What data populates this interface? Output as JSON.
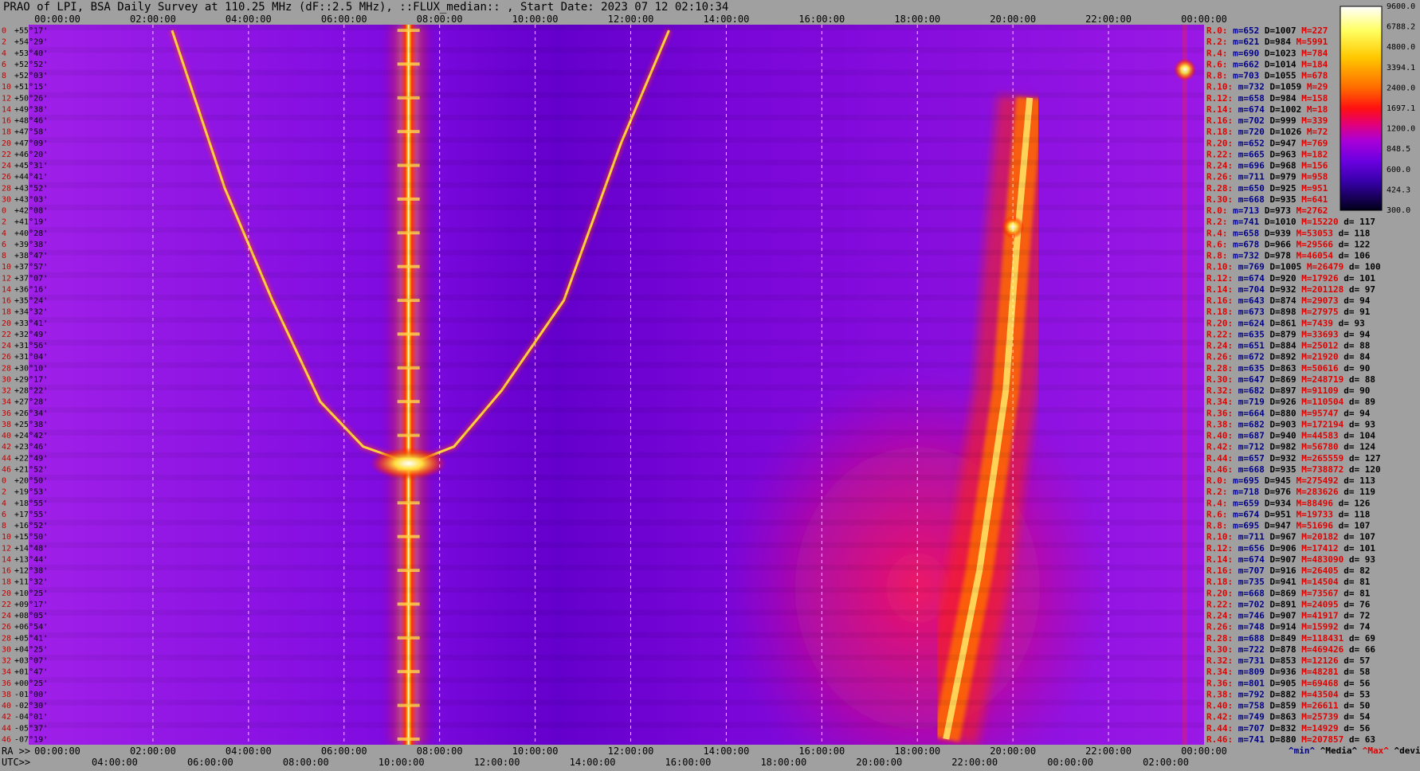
{
  "title": "PRAO of LPI, BSA Daily Survey at 110.25 MHz (dF::2.5 MHz), ::FLUX_median:: , Start Date: 2023 07 12 02:10:34",
  "x_axis_top_ticks": [
    "00:00:00",
    "02:00:00",
    "04:00:00",
    "06:00:00",
    "08:00:00",
    "10:00:00",
    "12:00:00",
    "14:00:00",
    "16:00:00",
    "18:00:00",
    "20:00:00",
    "22:00:00",
    "00:00:00"
  ],
  "x_axis_bottom_ra_ticks": [
    "00:00:00",
    "02:00:00",
    "04:00:00",
    "06:00:00",
    "08:00:00",
    "10:00:00",
    "12:00:00",
    "14:00:00",
    "16:00:00",
    "18:00:00",
    "20:00:00",
    "22:00:00",
    "00:00:00"
  ],
  "x_axis_bottom_utc_ticks": [
    "04:00:00",
    "06:00:00",
    "08:00:00",
    "10:00:00",
    "12:00:00",
    "14:00:00",
    "16:00:00",
    "18:00:00",
    "20:00:00",
    "22:00:00",
    "00:00:00",
    "02:00:00"
  ],
  "ra_label": "RA >>",
  "utc_label": "UTC>>",
  "row_index_labels": [
    "0",
    "2",
    "4",
    "6",
    "8",
    "10",
    "12",
    "14",
    "16",
    "18",
    "20",
    "22",
    "24",
    "26",
    "28",
    "30",
    "0",
    "2",
    "4",
    "6",
    "8",
    "10",
    "12",
    "14",
    "16",
    "18",
    "20",
    "22",
    "24",
    "26",
    "28",
    "30",
    "32",
    "34",
    "36",
    "38",
    "40",
    "42",
    "44",
    "46",
    "0",
    "2",
    "4",
    "6",
    "8",
    "10",
    "12",
    "14",
    "16",
    "18",
    "20",
    "22",
    "24",
    "26",
    "28",
    "30",
    "32",
    "34",
    "36",
    "38",
    "40",
    "42",
    "44",
    "46"
  ],
  "dec_labels": [
    "+55°17'",
    "+54°29'",
    "+53°40'",
    "+52°52'",
    "+52°03'",
    "+51°15'",
    "+50°26'",
    "+49°38'",
    "+48°46'",
    "+47°58'",
    "+47°09'",
    "+46°20'",
    "+45°31'",
    "+44°41'",
    "+43°52'",
    "+43°03'",
    "+42°08'",
    "+41°19'",
    "+40°28'",
    "+39°38'",
    "+38°47'",
    "+37°57'",
    "+37°07'",
    "+36°16'",
    "+35°24'",
    "+34°32'",
    "+33°41'",
    "+32°49'",
    "+31°56'",
    "+31°04'",
    "+30°10'",
    "+29°17'",
    "+28°22'",
    "+27°28'",
    "+26°34'",
    "+25°38'",
    "+24°42'",
    "+23°46'",
    "+22°49'",
    "+21°52'",
    "+20°50'",
    "+19°53'",
    "+18°55'",
    "+17°55'",
    "+16°52'",
    "+15°50'",
    "+14°48'",
    "+13°44'",
    "+12°38'",
    "+11°32'",
    "+10°25'",
    "+09°17'",
    "+08°05'",
    "+06°54'",
    "+05°41'",
    "+04°25'",
    "+03°07'",
    "+01°47'",
    "+00°25'",
    "-01°00'",
    "-02°30'",
    "-04°01'",
    "-05°37'",
    "-07°19'"
  ],
  "stats": [
    {
      "r": "R.0:",
      "m": "m=652",
      "d": "D=1007",
      "h": "M=227",
      "dd": ""
    },
    {
      "r": "R.2:",
      "m": "m=621",
      "d": "D=984",
      "h": "M=5991",
      "dd": ""
    },
    {
      "r": "R.4:",
      "m": "m=690",
      "d": "D=1023",
      "h": "M=784",
      "dd": ""
    },
    {
      "r": "R.6:",
      "m": "m=662",
      "d": "D=1014",
      "h": "M=184",
      "dd": ""
    },
    {
      "r": "R.8:",
      "m": "m=703",
      "d": "D=1055",
      "h": "M=678",
      "dd": ""
    },
    {
      "r": "R.10:",
      "m": "m=732",
      "d": "D=1059",
      "h": "M=29",
      "dd": ""
    },
    {
      "r": "R.12:",
      "m": "m=658",
      "d": "D=984",
      "h": "M=158",
      "dd": ""
    },
    {
      "r": "R.14:",
      "m": "m=674",
      "d": "D=1002",
      "h": "M=18",
      "dd": ""
    },
    {
      "r": "R.16:",
      "m": "m=702",
      "d": "D=999",
      "h": "M=339",
      "dd": ""
    },
    {
      "r": "R.18:",
      "m": "m=720",
      "d": "D=1026",
      "h": "M=72",
      "dd": ""
    },
    {
      "r": "R.20:",
      "m": "m=652",
      "d": "D=947",
      "h": "M=769",
      "dd": ""
    },
    {
      "r": "R.22:",
      "m": "m=665",
      "d": "D=963",
      "h": "M=182",
      "dd": ""
    },
    {
      "r": "R.24:",
      "m": "m=696",
      "d": "D=968",
      "h": "M=156",
      "dd": ""
    },
    {
      "r": "R.26:",
      "m": "m=711",
      "d": "D=979",
      "h": "M=958",
      "dd": ""
    },
    {
      "r": "R.28:",
      "m": "m=650",
      "d": "D=925",
      "h": "M=951",
      "dd": ""
    },
    {
      "r": "R.30:",
      "m": "m=668",
      "d": "D=935",
      "h": "M=641",
      "dd": ""
    },
    {
      "r": "R.0:",
      "m": "m=713",
      "d": "D=973",
      "h": "M=2762",
      "dd": ""
    },
    {
      "r": "R.2:",
      "m": "m=741",
      "d": "D=1010",
      "h": "M=15220",
      "dd": "d= 117"
    },
    {
      "r": "R.4:",
      "m": "m=658",
      "d": "D=939",
      "h": "M=53053",
      "dd": "d= 118"
    },
    {
      "r": "R.6:",
      "m": "m=678",
      "d": "D=966",
      "h": "M=29566",
      "dd": "d= 122"
    },
    {
      "r": "R.8:",
      "m": "m=732",
      "d": "D=978",
      "h": "M=46054",
      "dd": "d= 106"
    },
    {
      "r": "R.10:",
      "m": "m=769",
      "d": "D=1005",
      "h": "M=26479",
      "dd": "d= 100"
    },
    {
      "r": "R.12:",
      "m": "m=674",
      "d": "D=920",
      "h": "M=17926",
      "dd": "d= 101"
    },
    {
      "r": "R.14:",
      "m": "m=704",
      "d": "D=932",
      "h": "M=201128",
      "dd": "d= 97"
    },
    {
      "r": "R.16:",
      "m": "m=643",
      "d": "D=874",
      "h": "M=29073",
      "dd": "d= 94"
    },
    {
      "r": "R.18:",
      "m": "m=673",
      "d": "D=898",
      "h": "M=27975",
      "dd": "d= 91"
    },
    {
      "r": "R.20:",
      "m": "m=624",
      "d": "D=861",
      "h": "M=7439",
      "dd": "d= 93"
    },
    {
      "r": "R.22:",
      "m": "m=635",
      "d": "D=879",
      "h": "M=33693",
      "dd": "d= 94"
    },
    {
      "r": "R.24:",
      "m": "m=651",
      "d": "D=884",
      "h": "M=25012",
      "dd": "d= 88"
    },
    {
      "r": "R.26:",
      "m": "m=672",
      "d": "D=892",
      "h": "M=21920",
      "dd": "d= 84"
    },
    {
      "r": "R.28:",
      "m": "m=635",
      "d": "D=863",
      "h": "M=50616",
      "dd": "d= 90"
    },
    {
      "r": "R.30:",
      "m": "m=647",
      "d": "D=869",
      "h": "M=248719",
      "dd": "d= 88"
    },
    {
      "r": "R.32:",
      "m": "m=682",
      "d": "D=897",
      "h": "M=91109",
      "dd": "d= 90"
    },
    {
      "r": "R.34:",
      "m": "m=719",
      "d": "D=926",
      "h": "M=110504",
      "dd": "d= 89"
    },
    {
      "r": "R.36:",
      "m": "m=664",
      "d": "D=880",
      "h": "M=95747",
      "dd": "d= 94"
    },
    {
      "r": "R.38:",
      "m": "m=682",
      "d": "D=903",
      "h": "M=172194",
      "dd": "d= 93"
    },
    {
      "r": "R.40:",
      "m": "m=687",
      "d": "D=940",
      "h": "M=44583",
      "dd": "d= 104"
    },
    {
      "r": "R.42:",
      "m": "m=712",
      "d": "D=982",
      "h": "M=56780",
      "dd": "d= 124"
    },
    {
      "r": "R.44:",
      "m": "m=657",
      "d": "D=932",
      "h": "M=265559",
      "dd": "d= 127"
    },
    {
      "r": "R.46:",
      "m": "m=668",
      "d": "D=935",
      "h": "M=738872",
      "dd": "d= 120"
    },
    {
      "r": "R.0:",
      "m": "m=695",
      "d": "D=945",
      "h": "M=275492",
      "dd": "d= 113"
    },
    {
      "r": "R.2:",
      "m": "m=718",
      "d": "D=976",
      "h": "M=283626",
      "dd": "d= 119"
    },
    {
      "r": "R.4:",
      "m": "m=659",
      "d": "D=934",
      "h": "M=88496",
      "dd": "d= 126"
    },
    {
      "r": "R.6:",
      "m": "m=674",
      "d": "D=951",
      "h": "M=19733",
      "dd": "d= 118"
    },
    {
      "r": "R.8:",
      "m": "m=695",
      "d": "D=947",
      "h": "M=51696",
      "dd": "d= 107"
    },
    {
      "r": "R.10:",
      "m": "m=711",
      "d": "D=967",
      "h": "M=20182",
      "dd": "d= 107"
    },
    {
      "r": "R.12:",
      "m": "m=656",
      "d": "D=906",
      "h": "M=17412",
      "dd": "d= 101"
    },
    {
      "r": "R.14:",
      "m": "m=674",
      "d": "D=907",
      "h": "M=483090",
      "dd": "d= 93"
    },
    {
      "r": "R.16:",
      "m": "m=707",
      "d": "D=916",
      "h": "M=26405",
      "dd": "d= 82"
    },
    {
      "r": "R.18:",
      "m": "m=735",
      "d": "D=941",
      "h": "M=14504",
      "dd": "d= 81"
    },
    {
      "r": "R.20:",
      "m": "m=668",
      "d": "D=869",
      "h": "M=73567",
      "dd": "d= 81"
    },
    {
      "r": "R.22:",
      "m": "m=702",
      "d": "D=891",
      "h": "M=24095",
      "dd": "d= 76"
    },
    {
      "r": "R.24:",
      "m": "m=746",
      "d": "D=907",
      "h": "M=41917",
      "dd": "d= 72"
    },
    {
      "r": "R.26:",
      "m": "m=748",
      "d": "D=914",
      "h": "M=15992",
      "dd": "d= 74"
    },
    {
      "r": "R.28:",
      "m": "m=688",
      "d": "D=849",
      "h": "M=118431",
      "dd": "d= 69"
    },
    {
      "r": "R.30:",
      "m": "m=722",
      "d": "D=878",
      "h": "M=469426",
      "dd": "d= 66"
    },
    {
      "r": "R.32:",
      "m": "m=731",
      "d": "D=853",
      "h": "M=12126",
      "dd": "d= 57"
    },
    {
      "r": "R.34:",
      "m": "m=809",
      "d": "D=936",
      "h": "M=48281",
      "dd": "d= 58"
    },
    {
      "r": "R.36:",
      "m": "m=801",
      "d": "D=905",
      "h": "M=69468",
      "dd": "d= 56"
    },
    {
      "r": "R.38:",
      "m": "m=792",
      "d": "D=882",
      "h": "M=43504",
      "dd": "d= 53"
    },
    {
      "r": "R.40:",
      "m": "m=758",
      "d": "D=859",
      "h": "M=26611",
      "dd": "d= 50"
    },
    {
      "r": "R.42:",
      "m": "m=749",
      "d": "D=863",
      "h": "M=25739",
      "dd": "d= 54"
    },
    {
      "r": "R.44:",
      "m": "m=707",
      "d": "D=832",
      "h": "M=14929",
      "dd": "d= 56"
    },
    {
      "r": "R.46:",
      "m": "m=741",
      "d": "D=880",
      "h": "M=207857",
      "dd": "d= 63"
    }
  ],
  "stats_footer": [
    "^min^",
    "^Media^",
    "^Max^",
    "^devia^"
  ],
  "colorbar": {
    "labels": [
      "9600.0",
      "6788.2",
      "4800.0",
      "3394.1",
      "2400.0",
      "1697.1",
      "1200.0",
      "848.5",
      "600.0",
      "424.3",
      "300.0"
    ],
    "stops": [
      "#ffffff",
      "#ffff40",
      "#ffc000",
      "#ff7000",
      "#ff0000",
      "#e0006a",
      "#9000e0",
      "#4800c8",
      "#200070",
      "#000020"
    ]
  },
  "chart_data": {
    "type": "heatmap",
    "title": "PRAO of LPI, BSA Daily Survey at 110.25 MHz (dF::2.5 MHz), ::FLUX_median:: , Start Date: 2023 07 12 02:10:34",
    "x_ra_hours": [
      0,
      24
    ],
    "x_ticks_ra": [
      "00:00:00",
      "02:00:00",
      "04:00:00",
      "06:00:00",
      "08:00:00",
      "10:00:00",
      "12:00:00",
      "14:00:00",
      "16:00:00",
      "18:00:00",
      "20:00:00",
      "22:00:00",
      "00:00:00"
    ],
    "x_ticks_utc": [
      "04:00:00",
      "06:00:00",
      "08:00:00",
      "10:00:00",
      "12:00:00",
      "14:00:00",
      "16:00:00",
      "18:00:00",
      "20:00:00",
      "22:00:00",
      "00:00:00",
      "02:00:00"
    ],
    "y_dec_range": [
      "+55°17'",
      "-07°19'"
    ],
    "rows": 64,
    "color_scale": "log",
    "color_range": [
      300.0,
      9600.0
    ],
    "features": [
      {
        "kind": "vertical_band",
        "ra_hours": 7.35,
        "intensity": "max"
      },
      {
        "kind": "faint_track",
        "ra_hours": 23.6
      },
      {
        "kind": "arc",
        "points_ra_row": [
          [
            2.4,
            0
          ],
          [
            3.5,
            14
          ],
          [
            4.5,
            24
          ],
          [
            5.5,
            33
          ],
          [
            6.4,
            37
          ],
          [
            7.4,
            38.5
          ],
          [
            8.3,
            37
          ],
          [
            9.3,
            32
          ],
          [
            10.6,
            24
          ],
          [
            11.8,
            10
          ],
          [
            12.8,
            0
          ]
        ]
      },
      {
        "kind": "diagonal_band",
        "points_ra_row": [
          [
            18.6,
            63
          ],
          [
            19.3,
            48
          ],
          [
            19.85,
            32
          ],
          [
            20.1,
            18
          ],
          [
            20.35,
            6
          ]
        ]
      },
      {
        "kind": "broad_glow",
        "ra_hours": [
          14,
          20
        ],
        "rows": [
          30,
          64
        ]
      },
      {
        "kind": "hotspot",
        "ra_hours": 20.0,
        "row": 17.5
      },
      {
        "kind": "hotspot",
        "ra_hours": 23.6,
        "row": 3.5
      }
    ]
  }
}
